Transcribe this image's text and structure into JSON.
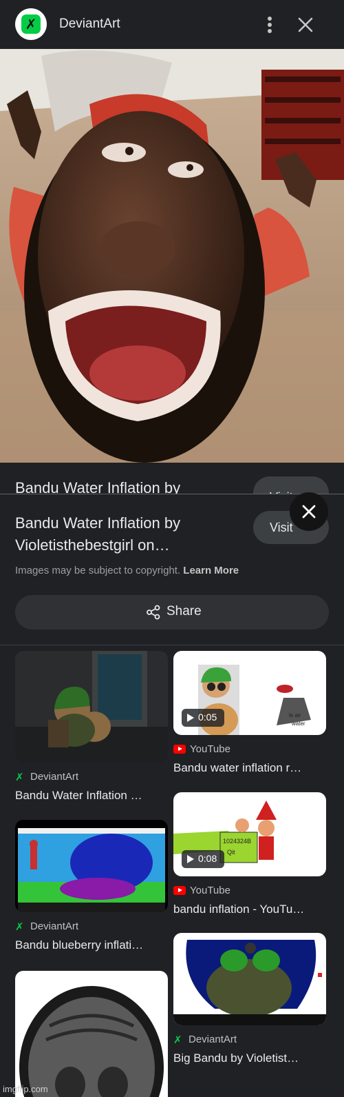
{
  "header": {
    "site_name": "DeviantArt",
    "logo_glyph": "✗"
  },
  "under": {
    "title": "Bandu Water Inflation by",
    "visit": "Visit"
  },
  "detail": {
    "title": "Bandu Water Inflation by Violetisthebestgirl on…",
    "visit_label": "Visit",
    "copyright_text": "Images may be subject to copyright.",
    "learn_more": "Learn More",
    "share_label": "Share"
  },
  "results": [
    {
      "source": "DeviantArt",
      "title": "Bandu Water Inflation …"
    },
    {
      "source": "YouTube",
      "title": "Bandu water inflation r…",
      "duration": "0:05",
      "thumb_texts": [
        "le air",
        "water"
      ]
    },
    {
      "source": "YouTube",
      "title": "bandu inflation - YouTu…",
      "duration": "0:08",
      "thumb_texts": [
        "1024324B",
        "Qit"
      ]
    },
    {
      "source": "DeviantArt",
      "title": "Bandu blueberry inflati…"
    },
    {
      "source": "DeviantArt",
      "title": "Big Bandu by Violetist…"
    }
  ],
  "watermark": "imgflip.com",
  "colors": {
    "background": "#202124",
    "button": "#3c4043",
    "share_button": "#303134",
    "deviantart_green": "#05cc47",
    "youtube_red": "#ff0000"
  },
  "icons": [
    "deviantart-logo-icon",
    "more-vert-icon",
    "close-icon",
    "share-icon",
    "play-icon",
    "youtube-icon"
  ]
}
